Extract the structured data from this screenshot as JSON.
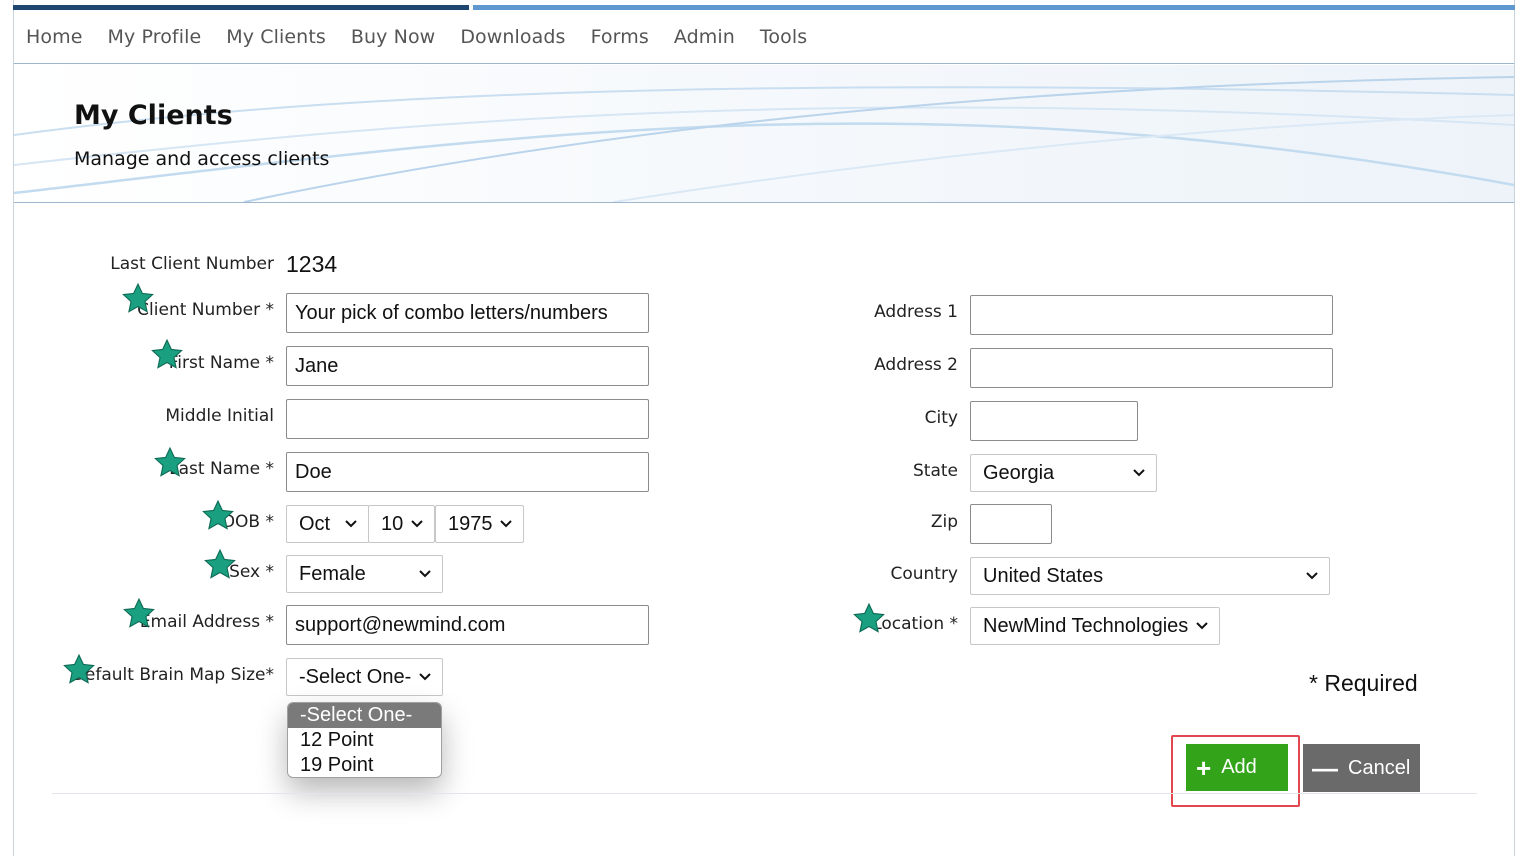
{
  "nav": {
    "items": [
      "Home",
      "My Profile",
      "My Clients",
      "Buy Now",
      "Downloads",
      "Forms",
      "Admin",
      "Tools"
    ]
  },
  "banner": {
    "title": "My Clients",
    "subtitle": "Manage and access clients"
  },
  "form": {
    "last_client_number": {
      "label": "Last Client Number",
      "value": "1234"
    },
    "client_number": {
      "label": "Client Number *",
      "value": "Your pick of combo letters/numbers"
    },
    "first_name": {
      "label": "First Name *",
      "value": "Jane"
    },
    "middle_initial": {
      "label": "Middle Initial",
      "value": ""
    },
    "last_name": {
      "label": "Last Name *",
      "value": "Doe"
    },
    "dob": {
      "label": "DOB *",
      "month": "Oct",
      "day": "10",
      "year": "1975"
    },
    "sex": {
      "label": "Sex *",
      "value": "Female"
    },
    "email": {
      "label": "Email Address *",
      "value": "support@newmind.com"
    },
    "brain_map_size": {
      "label": "Default Brain Map Size*",
      "value": "-Select One-",
      "options": [
        "-Select One-",
        "12 Point",
        "19 Point"
      ]
    },
    "address1": {
      "label": "Address 1",
      "value": ""
    },
    "address2": {
      "label": "Address 2",
      "value": ""
    },
    "city": {
      "label": "City",
      "value": ""
    },
    "state": {
      "label": "State",
      "value": "Georgia"
    },
    "zip": {
      "label": "Zip",
      "value": ""
    },
    "country": {
      "label": "Country",
      "value": "United States"
    },
    "location": {
      "label": "Location *",
      "value": "NewMind Technologies"
    },
    "required_note": "* Required"
  },
  "actions": {
    "add_label": "Add",
    "cancel_label": "Cancel"
  },
  "colors": {
    "nav_bar_dark": "#1d4670",
    "nav_bar_light": "#5e98cf",
    "add_button": "#33a41a",
    "cancel_button": "#6a6a6a",
    "star_annotation": "#1aa080",
    "highlight_box": "#e2474f"
  },
  "icons": {
    "annotation": "star-icon",
    "select_arrow": "chevron-down-icon",
    "add": "plus-icon",
    "cancel": "minus-icon"
  }
}
